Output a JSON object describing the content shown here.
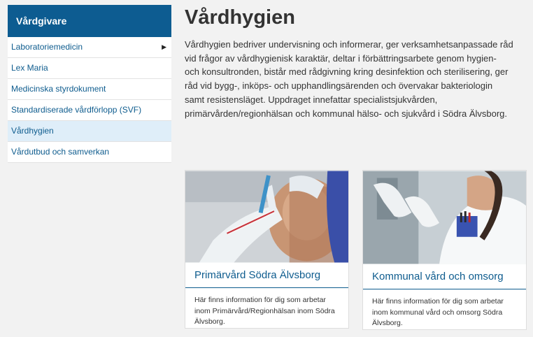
{
  "sidebar": {
    "header": "Vårdgivare",
    "items": [
      {
        "label": "Laboratoriemedicin",
        "caret": "▶"
      },
      {
        "label": "Lex Maria"
      },
      {
        "label": "Medicinska styrdokument"
      },
      {
        "label": "Standardiserade vårdförlopp (SVF)"
      },
      {
        "label": "Vårdhygien"
      },
      {
        "label": "Vårdutbud och samverkan"
      }
    ]
  },
  "main": {
    "title": "Vårdhygien",
    "intro": "Vårdhygien bedriver undervisning och informerar, ger verksamhetsanpassade råd vid frågor av vårdhygienisk karaktär, deltar i förbättringsarbete genom hygien- och konsultronden, bistår med rådgivning kring desinfektion och sterilisering, ger råd vid bygg-, inköps- och upphandlingsärenden och övervakar bakteriologin samt resistensläget. Uppdraget innefattar specialistsjukvården, primärvården/regionhälsan och kommunal hälso- och sjukvård i Södra Älvsborg.",
    "cards": [
      {
        "title": "Primärvård Södra Älvsborg",
        "text": "Här finns information för dig som arbetar inom Primärvård/Regionhälsan inom Södra Älvsborg."
      },
      {
        "title": "Kommunal vård och omsorg",
        "text": "Här finns information för dig som arbetar inom kommunal vård och omsorg Södra Älvsborg."
      }
    ]
  }
}
